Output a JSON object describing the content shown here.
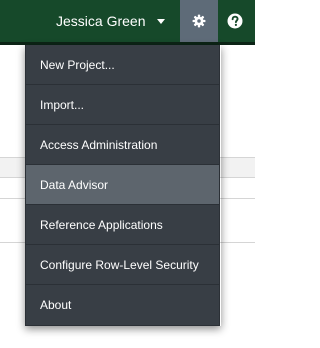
{
  "header": {
    "user_name": "Jessica Green",
    "settings_icon": "gear-icon",
    "help_icon": "question-icon",
    "colors": {
      "bar": "#16492a",
      "settings_active": "#5e6b78"
    }
  },
  "menu": {
    "items": [
      {
        "label": "New Project..."
      },
      {
        "label": "Import..."
      },
      {
        "label": "Access Administration"
      },
      {
        "label": "Data Advisor"
      },
      {
        "label": "Reference Applications"
      },
      {
        "label": "Configure Row-Level Security"
      },
      {
        "label": "About"
      }
    ],
    "highlighted": "Data Advisor",
    "colors": {
      "background": "#383e45",
      "highlight": "#5d656d"
    }
  }
}
